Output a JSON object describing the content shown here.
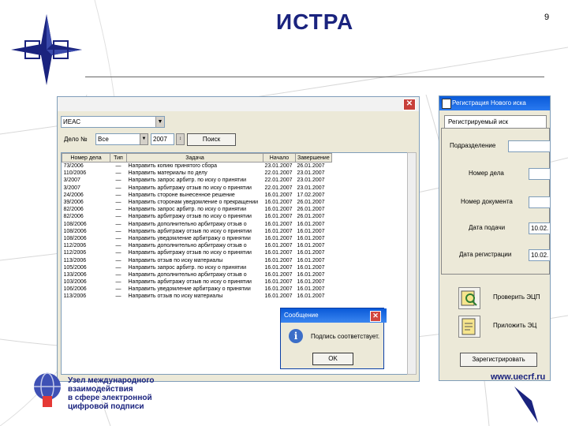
{
  "slide": {
    "title": "ИСТРА",
    "page_number": "9",
    "url": "www.uecrf.ru",
    "logo_text": [
      "Узел международного",
      "взаимодействия",
      "в сфере электронной",
      "цифровой подписи"
    ]
  },
  "main_window": {
    "case_type": "ИЕАС",
    "case_label": "Дело №",
    "filter_value": "Все",
    "year_value": "2007",
    "search_label": "Поиск",
    "columns": [
      "Номер дела",
      "Тип",
      "Задача",
      "Начало",
      "Завершение"
    ],
    "rows": [
      [
        "73/2006",
        "—",
        "Направить копию принятого сбора",
        "23.01.2007",
        "26.01.2007"
      ],
      [
        "110/2006",
        "—",
        "Направить материалы по делу",
        "22.01.2007",
        "23.01.2007"
      ],
      [
        "3/2007",
        "—",
        "Направить запрос арбитр. по иску о принятии",
        "22.01.2007",
        "23.01.2007"
      ],
      [
        "3/2007",
        "—",
        "Направить арбитражу отзыв по иску о принятии",
        "22.01.2007",
        "23.01.2007"
      ],
      [
        "24/2006",
        "—",
        "Направить стороне вынесенное решение",
        "16.01.2007",
        "17.02.2007"
      ],
      [
        "39/2006",
        "—",
        "Направить сторонам уведомление о прекращении",
        "16.01.2007",
        "26.01.2007"
      ],
      [
        "82/2006",
        "—",
        "Направить запрос арбитр. по иску о принятии",
        "16.01.2007",
        "26.01.2007"
      ],
      [
        "82/2006",
        "—",
        "Направить арбитражу отзыв по иску о принятии",
        "16.01.2007",
        "26.01.2007"
      ],
      [
        "108/2006",
        "—",
        "Направить дополнительно арбитражу отзыв о",
        "16.01.2007",
        "16.01.2007"
      ],
      [
        "108/2006",
        "—",
        "Направить арбитражу отзыв по иску о принятии",
        "16.01.2007",
        "16.01.2007"
      ],
      [
        "108/2006",
        "—",
        "Направить уведомление арбитражу о принятии",
        "16.01.2007",
        "16.01.2007"
      ],
      [
        "112/2006",
        "—",
        "Направить дополнительно арбитражу отзыв о",
        "16.01.2007",
        "16.01.2007"
      ],
      [
        "112/2006",
        "—",
        "Направить арбитражу отзыв по иску о принятии",
        "16.01.2007",
        "16.01.2007"
      ],
      [
        "113/2006",
        "—",
        "Направить отзыв по иску материалы",
        "16.01.2007",
        "16.01.2007"
      ],
      [
        "105/2006",
        "—",
        "Направить запрос арбитр. по иску о принятии",
        "16.01.2007",
        "16.01.2007"
      ],
      [
        "133/2006",
        "—",
        "Направить дополнительно арбитражу отзыв о",
        "16.01.2007",
        "16.01.2007"
      ],
      [
        "103/2006",
        "—",
        "Направить арбитражу отзыв по иску о принятии",
        "16.01.2007",
        "16.01.2007"
      ],
      [
        "106/2006",
        "—",
        "Направить уведомление арбитражу о принятии",
        "16.01.2007",
        "16.01.2007"
      ],
      [
        "113/2006",
        "—",
        "Направить отзыв по иску материалы",
        "16.01.2007",
        "16.01.2007"
      ]
    ]
  },
  "register_window": {
    "title": "Регистрация Нового иска",
    "tab_label": "Регистрируемый иск",
    "fields": [
      {
        "label": "Подразделение",
        "value": ""
      },
      {
        "label": "Номер дела",
        "value": ""
      },
      {
        "label": "Номер документа",
        "value": ""
      },
      {
        "label": "Дата подачи",
        "value": "10.02."
      },
      {
        "label": "Дата регистрации",
        "value": "10.02."
      }
    ],
    "action1": "Проверить ЭЦП",
    "action2": "Приложить ЭЦ",
    "register_button": "Зарегистрировать"
  },
  "dialog": {
    "title": "Сообщение",
    "message": "Подпись соответствует.",
    "ok_label": "OK"
  }
}
